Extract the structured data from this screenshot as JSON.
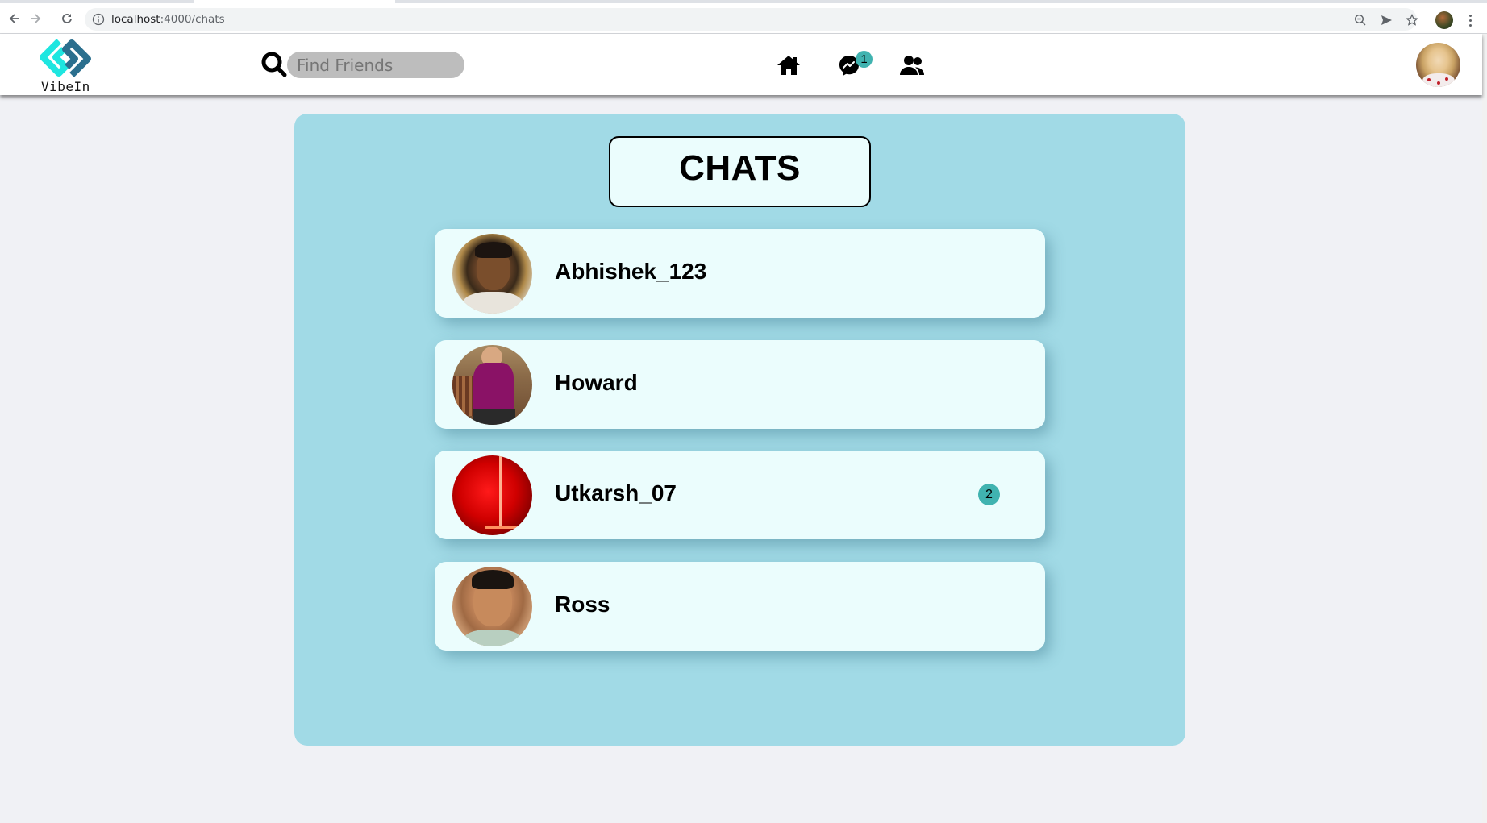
{
  "browser": {
    "url_host": "localhost",
    "url_rest": ":4000/chats",
    "icons": [
      "back-icon",
      "forward-icon",
      "reload-icon",
      "info-icon",
      "zoom-out-icon",
      "send-icon",
      "bookmark-star-icon",
      "profile-icon",
      "menu-icon"
    ]
  },
  "nav": {
    "logo_text": "VibeIn",
    "search_placeholder": "Find Friends",
    "search_value": "",
    "messages_badge": "1",
    "icons": [
      "home-icon",
      "messenger-icon",
      "friends-icon"
    ]
  },
  "page": {
    "title": "CHATS"
  },
  "chats": [
    {
      "name": "Abhishek_123",
      "unread": ""
    },
    {
      "name": "Howard",
      "unread": ""
    },
    {
      "name": "Utkarsh_07",
      "unread": "2"
    },
    {
      "name": "Ross",
      "unread": ""
    }
  ],
  "colors": {
    "panel": "#a1dae6",
    "card": "#ebfdfd",
    "badge": "#40b3b0",
    "logo_cyan": "#1ee6e0",
    "logo_blue": "#2b6f8e"
  }
}
